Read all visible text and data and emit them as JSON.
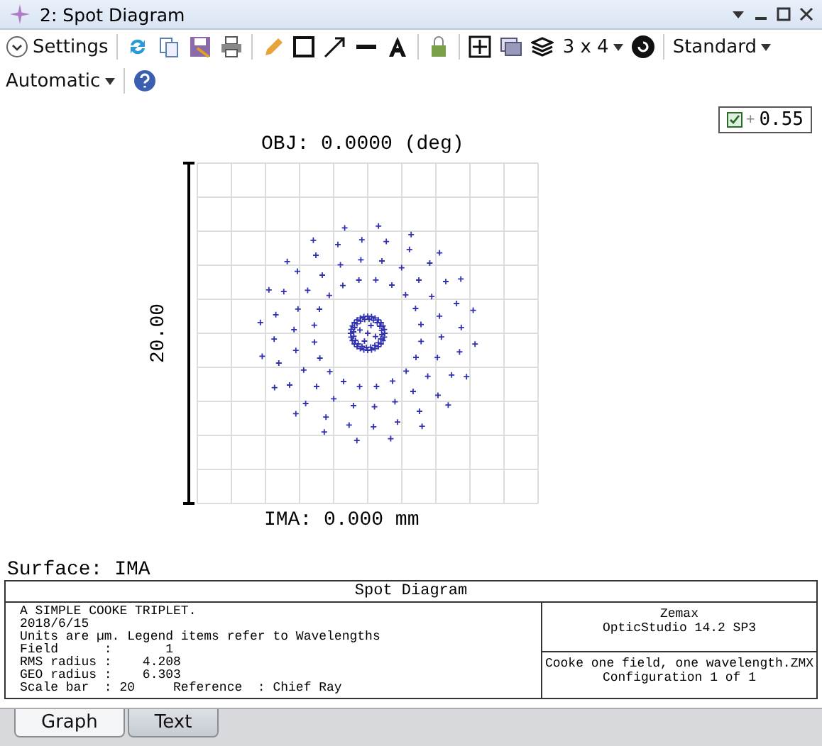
{
  "window": {
    "title": "2: Spot Diagram"
  },
  "toolbar": {
    "settings": "Settings",
    "layout": "3 x 4",
    "style": "Standard",
    "scale": "Automatic"
  },
  "legend": {
    "checked": true,
    "symbol": "+",
    "value": "0.55"
  },
  "plot": {
    "title": "OBJ: 0.0000 (deg)",
    "scale_label": "20.00",
    "footer": "IMA: 0.000 mm"
  },
  "surface": "Surface: IMA",
  "info": {
    "title": "Spot Diagram",
    "lines": [
      "A SIMPLE COOKE TRIPLET.",
      "2018/6/15",
      "Units are µm. Legend items refer to Wavelengths",
      "Field      :       1",
      "RMS radius :    4.208",
      "GEO radius :    6.303",
      "Scale bar  : 20     Reference  : Chief Ray"
    ],
    "program": [
      "Zemax",
      "OpticStudio 14.2 SP3"
    ],
    "file": [
      "Cooke one field, one wavelength.ZMX",
      "Configuration 1 of 1"
    ]
  },
  "tabs": [
    {
      "label": "Graph",
      "selected": true
    },
    {
      "label": "Text",
      "selected": false
    }
  ]
}
